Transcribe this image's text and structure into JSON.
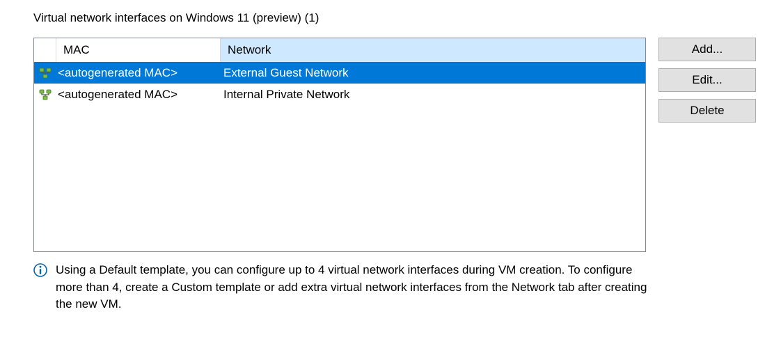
{
  "title": "Virtual network interfaces on Windows 11 (preview) (1)",
  "columns": {
    "mac": "MAC",
    "network": "Network"
  },
  "rows": [
    {
      "mac": "<autogenerated MAC>",
      "network": "External Guest Network",
      "selected": true
    },
    {
      "mac": "<autogenerated MAC>",
      "network": "Internal Private Network",
      "selected": false
    }
  ],
  "buttons": {
    "add": "Add...",
    "edit": "Edit...",
    "delete": "Delete"
  },
  "info": "Using a Default template, you can configure up to 4 virtual network interfaces during VM creation. To configure more than 4, create a Custom template or add extra virtual network interfaces from the Network tab after creating the new VM."
}
